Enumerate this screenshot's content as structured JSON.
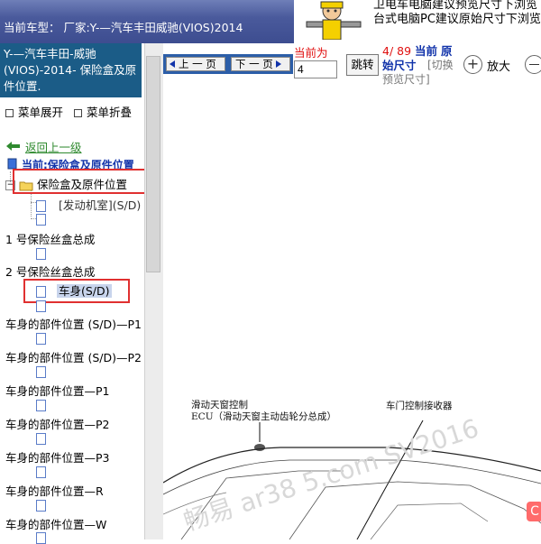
{
  "header": {
    "car_label": "当前车型：  厂家:Y-—汽车丰田威驰(VIOS)2014",
    "promo_line1": "卫电车电脑建议预览尺寸下浏览",
    "promo_line2": "台式电脑PC建议原始尺寸下浏览"
  },
  "sidebar": {
    "title": "Y-—汽车丰田-威驰(VIOS)-2014- 保险盒及原件位置.",
    "menu_expand": "菜单展开",
    "menu_collapse": "菜单折叠",
    "back_link": "返回上一级",
    "current": "当前:保险盒及原件位置",
    "tree": [
      {
        "label": "保险盒及原件位置",
        "type": "folder"
      },
      {
        "label": "[发动机室](S/D)",
        "type": "page"
      },
      {
        "label": "",
        "type": "page"
      },
      {
        "label": "1 号保险丝盒总成",
        "type": "group"
      },
      {
        "label": "",
        "type": "page"
      },
      {
        "label": "2 号保险丝盒总成",
        "type": "group"
      },
      {
        "label": "车身(S/D)",
        "type": "page"
      },
      {
        "label": "",
        "type": "page"
      },
      {
        "label": "车身的部件位置 (S/D)—P1",
        "type": "group"
      },
      {
        "label": "车身的部件位置 (S/D)—P2",
        "type": "group"
      },
      {
        "label": "车身的部件位置—P1",
        "type": "group"
      },
      {
        "label": "车身的部件位置—P2",
        "type": "group"
      },
      {
        "label": "车身的部件位置—P3",
        "type": "group"
      },
      {
        "label": "车身的部件位置—R",
        "type": "group"
      },
      {
        "label": "车身的部件位置—W",
        "type": "group"
      }
    ]
  },
  "toolbar": {
    "prev_label": "上 一 页",
    "next_label": "下 一 页",
    "current_label": "当前为",
    "page_value": "4",
    "jump_label": "跳转",
    "page_fraction": "4/ 89",
    "current_word": "当前",
    "orig_word": "原",
    "orig_size": "始尺寸",
    "switch_label": "[切换",
    "preview_label": "预览尺寸]",
    "zoom_in_label": "放大"
  },
  "diagram": {
    "label_sunroof_1": "滑动天窗控制",
    "label_sunroof_2": "ECU（滑动天窗主动齿轮分总成）",
    "label_door": "车门控制接收器",
    "watermark": "畅易 ar38 5.com SV2016"
  },
  "colors": {
    "header_blue": "#4a5a9c",
    "sidebar_title_bg": "#1b5c87",
    "nav_strip": "#2c5ea8",
    "highlight_red": "#e03030",
    "link_green": "#2f8a2f"
  }
}
